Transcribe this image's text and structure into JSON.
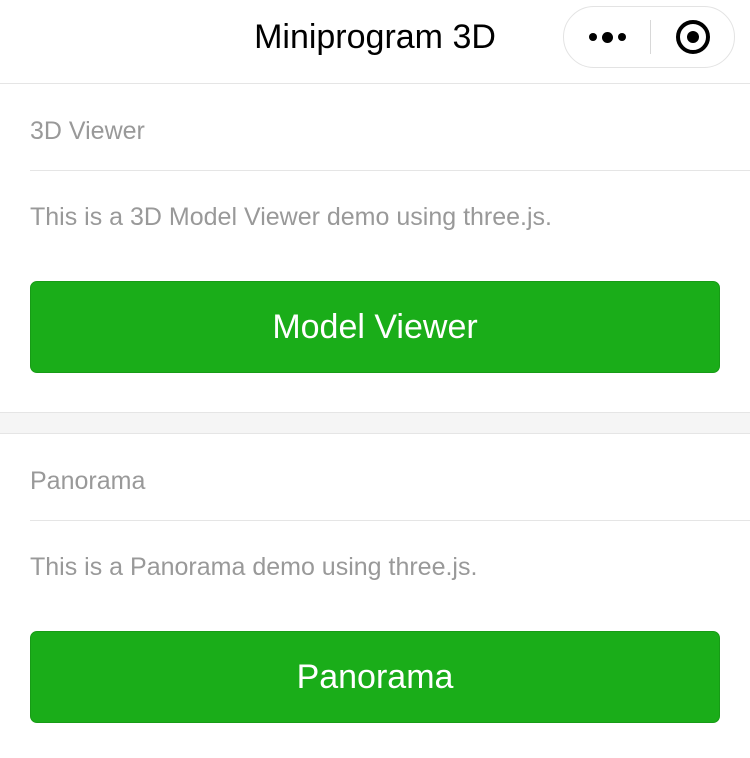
{
  "nav": {
    "title": "Miniprogram 3D"
  },
  "sections": [
    {
      "header": "3D Viewer",
      "description": "This is a 3D Model Viewer demo using three.js.",
      "button_label": "Model Viewer"
    },
    {
      "header": "Panorama",
      "description": "This is a Panorama demo using three.js.",
      "button_label": "Panorama"
    }
  ],
  "colors": {
    "accent": "#1aad19",
    "muted_text": "#999999"
  },
  "icons": {
    "more": "more-dots-icon",
    "close": "capsule-close-icon"
  }
}
